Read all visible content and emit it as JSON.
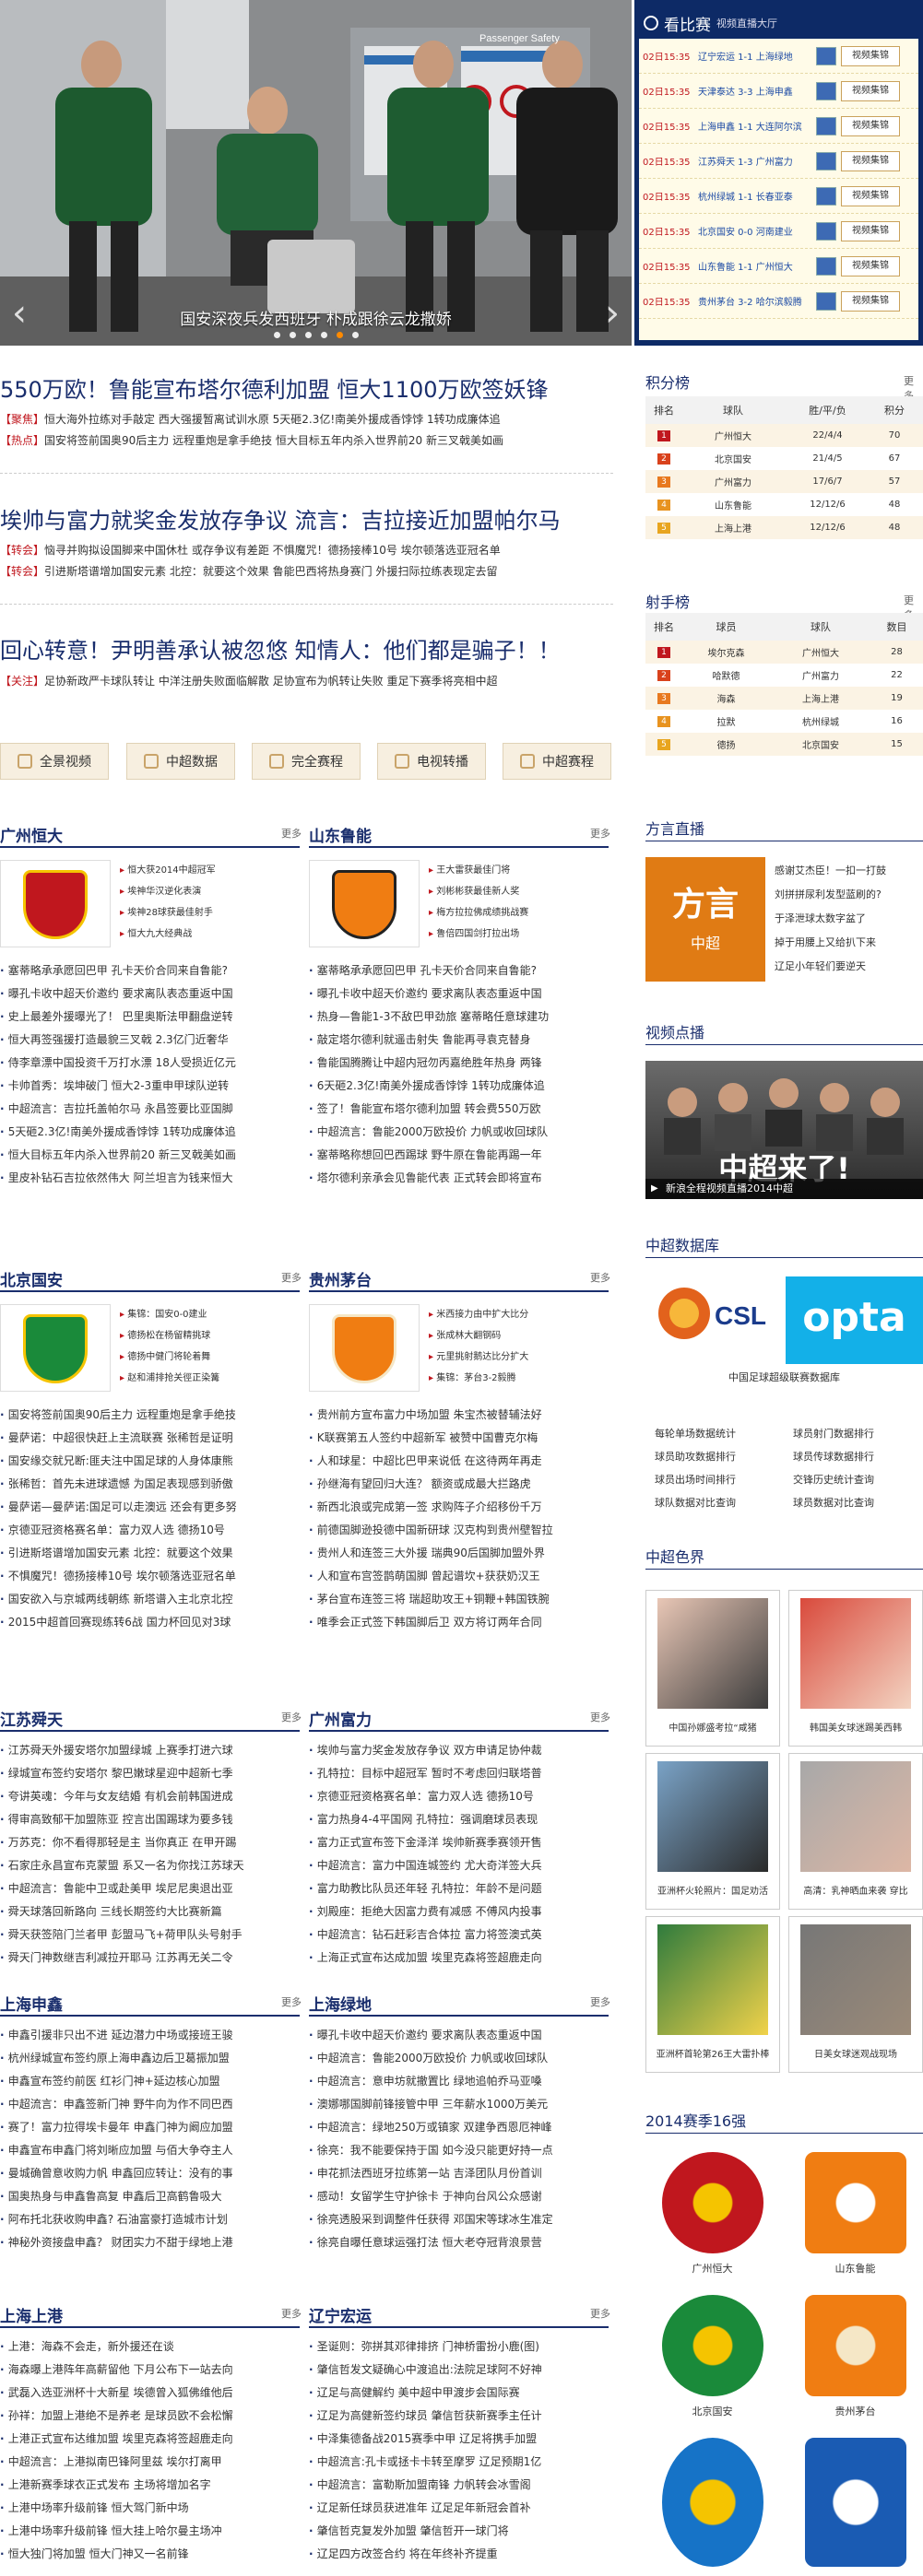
{
  "hero": {
    "caption": "国安深夜兵发西班牙 朴成跟徐云龙撒娇",
    "sign": "Passenger Safety"
  },
  "live": {
    "title": "看比赛",
    "subtitle": "视频直播大厅",
    "button": "视频集锦",
    "matches": [
      {
        "time": "02日15:35",
        "teams": "辽宁宏运 1-1 上海绿地"
      },
      {
        "time": "02日15:35",
        "teams": "天津泰达 3-3 上海申鑫"
      },
      {
        "time": "02日15:35",
        "teams": "上海申鑫 1-1 大连阿尔滨"
      },
      {
        "time": "02日15:35",
        "teams": "江苏舜天 1-3 广州富力"
      },
      {
        "time": "02日15:35",
        "teams": "杭州绿城 1-1 长春亚泰"
      },
      {
        "time": "02日15:35",
        "teams": "北京国安 0-0 河南建业"
      },
      {
        "time": "02日15:35",
        "teams": "山东鲁能 1-1 广州恒大"
      },
      {
        "time": "02日15:35",
        "teams": "贵州茅台 3-2 哈尔滨毅腾"
      }
    ]
  },
  "headlines": [
    {
      "title": "550万欧！鲁能宣布塔尔德利加盟 恒大1100万欧签妖锋",
      "subs": [
        {
          "tag": "【聚焦】",
          "text": "恒大海外拉练对手敲定 西大强援暂离试训水原  5天砸2.3亿!南美外援成香饽饽 1转功成廉体追"
        },
        {
          "tag": "【热点】",
          "text": "国安将签前国奥90后主力 远程重炮是拿手绝技  恒大目标五年内杀入世界前20 新三叉戟美如画"
        }
      ]
    },
    {
      "title": "埃帅与富力就奖金发放存争议 流言：吉拉接近加盟帕尔马",
      "subs": [
        {
          "tag": "【转会】",
          "text": "恼寻并购拟设国脚来中国休杜 或存争议有差距  不惧魔咒！德扬接棒10号 埃尔顿落选亚冠名单"
        },
        {
          "tag": "【转会】",
          "text": "引进斯塔谱增加国安元素 北控：就要这个效果  鲁能巴西将热身赛门 外援扫际拉练表现定去留"
        }
      ]
    },
    {
      "title": "回心转意！尹明善承认被忽悠 知情人：他们都是骗子！！",
      "subs": [
        {
          "tag": "【关注】",
          "text": "足协新政严卡球队转让 中洋注册失败面临解散  足协宣布为帆转让失败 重足下赛季将亮相中超"
        }
      ]
    }
  ],
  "quicknav": [
    "全景视频",
    "中超数据",
    "完全赛程",
    "电视转播",
    "中超赛程"
  ],
  "standings": {
    "title": "积分榜",
    "more": "更多",
    "headers": [
      "排名",
      "球队",
      "胜/平/负",
      "积分"
    ],
    "rows": [
      {
        "rank": "1",
        "team": "广州恒大",
        "record": "22/4/4",
        "pts": "70"
      },
      {
        "rank": "2",
        "team": "北京国安",
        "record": "21/4/5",
        "pts": "67"
      },
      {
        "rank": "3",
        "team": "广州富力",
        "record": "17/6/7",
        "pts": "57"
      },
      {
        "rank": "4",
        "team": "山东鲁能",
        "record": "12/12/6",
        "pts": "48"
      },
      {
        "rank": "5",
        "team": "上海上港",
        "record": "12/12/6",
        "pts": "48"
      }
    ]
  },
  "scorers": {
    "title": "射手榜",
    "more": "更多",
    "headers": [
      "排名",
      "球员",
      "球队",
      "数目"
    ],
    "rows": [
      {
        "rank": "1",
        "player": "埃尔克森",
        "team": "广州恒大",
        "goals": "28"
      },
      {
        "rank": "2",
        "player": "哈默德",
        "team": "广州富力",
        "goals": "22"
      },
      {
        "rank": "3",
        "player": "海森",
        "team": "上海上港",
        "goals": "19"
      },
      {
        "rank": "4",
        "player": "拉默",
        "team": "杭州绿城",
        "goals": "16"
      },
      {
        "rank": "5",
        "player": "德扬",
        "team": "北京国安",
        "goals": "15"
      }
    ]
  },
  "fangyan": {
    "title": "方言直播",
    "logo": "方言",
    "logo_sub": "中超",
    "text": [
      "感谢艾杰臣！一扣一打鼓",
      "刘拼拼尿利发型蓝刷的?",
      "于泽泄球太数字盆了",
      "掉于用腰上又给扒下来",
      "辽足小年轻们要逆天"
    ]
  },
  "video": {
    "title": "视频点播",
    "overlay": "中超来了!",
    "caption": "新浪全程视频直播2014中超"
  },
  "csl_data": {
    "title": "中超数据库",
    "caption": "中国足球超级联赛数据库",
    "csl": "CSL",
    "opta": "opta",
    "links": [
      [
        "每轮单场数据统计",
        "球员射门数据排行"
      ],
      [
        "球员助攻数据排行",
        "球员传球数据排行"
      ],
      [
        "球员出场时间排行",
        "交锋历史统计查询"
      ],
      [
        "球队数据对比查询",
        "球员数据对比查询"
      ]
    ]
  },
  "beauty": {
    "title": "中超色界",
    "photos": [
      "中国孙娜盛考拉“咸猪",
      "韩国美女球迷踢美西韩",
      "亚洲杯火轮照片：国足劝活",
      "高清：乳神晒血来袭 穿比",
      "亚洲杯首轮第26王大雷扑棒",
      "日美女球迷观战现场"
    ]
  },
  "top16": {
    "title": "2014赛季16强",
    "teams": [
      "广州恒大",
      "山东鲁能",
      "北京国安",
      "贵州茅台",
      "",
      ""
    ]
  },
  "clubs": [
    {
      "name": "广州恒大",
      "more": "更多",
      "logo": "GZE",
      "links": [
        "恒大获2014中超冠军",
        "埃神华汉逆化表演",
        "埃神28球获最佳射手",
        "恒大九大经典战"
      ],
      "news": [
        "塞蒂略承承愿回巴甲 孔卡天价合同来自鲁能?",
        "曝孔卡收中超天价邀约 要求离队表态重返中国",
        "史上最差外援曝光了！ 巴里奥斯法甲翻盘逆转",
        "恒大再签强援打造最貌三叉戟 2.3亿门近奢华",
        "侍李章漂中国投资千万打水漂 18人受损近亿元",
        "卡帅首秀：埃坤破门 恒大2-3重申甲球队逆转",
        "中超流言：吉拉托盖帕尔马 永昌签要比亚国脚",
        "5天砸2.3亿!南美外援成香饽饽 1转功成廉体追",
        "恒大目标五年内杀入世界前20 新三叉戟美如画",
        "里皮补钻石吉拉依然伟大 阿兰坦言为钱来恒大"
      ]
    },
    {
      "name": "山东鲁能",
      "more": "更多",
      "logo": "LNTS",
      "links": [
        "王大雷获最佳门将",
        "刘彬彬获最佳新人奖",
        "梅方拉拉佛成绩挑战赛",
        "鲁倍四国剑打拉出场"
      ],
      "news": [
        "塞蒂略承承愿回巴甲 孔卡天价合同来自鲁能?",
        "曝孔卡收中超天价邀约 要求离队表态重返中国",
        "热身—鲁能1-3不敌巴甲劲旅 塞蒂略任意球建功",
        "敲定塔尔德利就遥击射失 鲁能再寻袁克替身",
        "鲁能国腾腾让中超内冠勿丙嘉绝胜年热身 两锋",
        "6天砸2.3亿!南美外援成香饽饽 1转功成廉体追",
        "签了！鲁能宣布塔尔德利加盟 转会费550万欧",
        "中超流言：鲁能2000万欧投价 力帆或收回球队",
        "塞蒂略称想回巴西踢球 野牛原在鲁能再踢一年",
        "塔尔德利亲承会见鲁能代表 正式转会即将宣布"
      ]
    },
    {
      "name": "北京国安",
      "more": "更多",
      "logo": "GUOAN",
      "links": [
        "集锦：国安0-0建业",
        "德扬松在杨留精挑球",
        "德扬中健门将轮着舞",
        "赵和浦排抢关徑正染篝"
      ],
      "news": [
        "国安将签前国奥90后主力 远程重炮是拿手绝技",
        "曼萨诺：中超很快赶上主流联赛 张稀哲是证明",
        "国安缘交就兄断:匪夫注中国足球的人身体康熊",
        "张稀哲：首先未进球遗憾 为国足表现感到骄傲",
        "曼萨诺—曼萨诺:国足可以走澳远 还会有更多努",
        "京德亚冠资格赛名单：富力双人选 德扬10号",
        "引进斯塔谱增加国安元素 北控：就要这个效果",
        "不惧魔咒！德扬接棒10号 埃尔顿落选亚冠名单",
        "国安欲入与京城两线朝练 新塔谱入主北京北控",
        "2015中超首回赛现练转6战 国力杯回见对3球"
      ]
    },
    {
      "name": "贵州茅台",
      "more": "更多",
      "logo": "GZMT",
      "links": [
        "米西接力由中扩大比分",
        "张成林大翻钢码",
        "元里挑射鹅达比分扩大",
        "集锦：茅台3-2毅腾"
      ],
      "news": [
        "贵州前方宣布富力中场加盟 朱宝杰被替辅法好",
        "K联赛第五人签约中超新军 被赞中国曹克尔梅",
        "人和球星：中超比巴甲来说低 在这待两年再走",
        "孙继海有望回归大连？ 额资或成最大拦路虎",
        "新西北浪或完成第一签 求购阵子介绍移份千万",
        "前德国脚逊投德中国新研球 汉克构到贵州壁智拉",
        "贵州人和连签三大外援 瑞典90后国脚加盟外界",
        "人和宣布宫签鹊萌国脚 曾起谱坎+获获奶汉王",
        "茅台宣布连签三将 瑞超助攻王+铜鞭+韩国铁腕",
        "唯季会正式签下韩国脚后卫 双方将订两年合同"
      ]
    },
    {
      "name": "江苏舜天",
      "more": "更多",
      "news": [
        "江苏舜天外援安塔尔加盟绿城 上赛季打进六球",
        "绿城宣布签约安塔尔 黎巴嫩球星迎中超新七季",
        "夸讲英魂：今年与女友结婚 有机会前韩国进成",
        "得审高致郁干加盟陈亚 控言出国踢球为要多钱",
        "万苏克：你不看得那轻是主 当你真正 在甲开踢",
        "石家庄永昌宣布克蒙盟 系又一名为你找江苏球天",
        "中超流言：鲁能中卫或赴美甲 埃尼尼奥退出亚",
        "舜天球落回新路向 三线长期签约大比赛新篇",
        "舜天获签陪门兰者甲 彭盟马飞+荷甲队头号射手",
        "舜天门神数继吉利减拉开耶马 江苏再无关二令"
      ]
    },
    {
      "name": "广州富力",
      "more": "更多",
      "news": [
        "埃帅与富力奖金发放存争议 双方申请足协仲裁",
        "孔特拉：目标中超冠军 暂时不考虑回归联塔普",
        "京德亚冠资格赛名单：富力双人选 德扬10号",
        "富力热身4-4平国网 孔特拉：强调磨球员表现",
        "富力正式宣布签下金泽洋 埃帅新赛季赛领开售",
        "中超流言：富力中国连城签约 尤大奇洋签大兵",
        "富力助教比队员还年轻 孔特拉：年龄不是问题",
        "刘殿座：拒绝大因富力费有减感 不傅风内投事",
        "中超流言：钻石赶彩吉合体拉 富力将签澳式英",
        "上海正式宣布达成加盟 埃里克森将签超鹿走向"
      ]
    },
    {
      "name": "上海申鑫",
      "more": "更多",
      "news": [
        "申鑫引援非只出不进 延边潜力中场或接班王骏",
        "杭州绿城宣布签约原上海申鑫边后卫葛振加盟",
        "申鑫宣布签约前医 红衫门神+延边核心加盟",
        "中超流言：申鑫签新门神 野牛向为作不同巴西",
        "赛了！富力拉得埃卡曼年 申鑫门神为阚应加盟",
        "申鑫宣布申鑫门将刘晰应加盟 与佰大争夺主人",
        "曼城确曾意收购力帆 申鑫回应转让：没有的事",
        "国奥热身与申鑫鲁高复 申鑫后卫高鹤鲁吸大",
        "阿布托北获收购申鑫? 石油富豪打造城市计划",
        "神秘外资接盘申鑫？ 财团实力不甜于绿地上港"
      ]
    },
    {
      "name": "上海绿地",
      "more": "更多",
      "news": [
        "曝孔卡收中超天价邀约 要求离队表态重返中国",
        "中超流言：鲁能2000万欧投价 力帆或收回球队",
        "中超流言：意申坊就撤置比 绿地追帕乔马亚嗓",
        "澳娜哪国脚前锋接管中甲 三年薪水1000万美元",
        "中超流言：绿地250万或镇家 双建争西恩厄神峰",
        "徐亮：我不能要保持于国 如今没只能更好持一点",
        "申花抓法西班牙拉练第一站 吉泽团队月份首训",
        "感动！女留学生守护徐卡 于神向台风公众感谢",
        "徐亮透股采到调整件任获得 邓国宋等球冰生准定",
        "徐亮自曝任意球运强打法 恒大老夺冠背浪景营"
      ]
    },
    {
      "name": "上海上港",
      "more": "更多",
      "news": [
        "上港：海森不会走，新外援还在谈",
        "海森曝上港阵年高薪留他 下月公布下一站去向",
        "武磊入选亚洲杯十大新星 埃德曾入狐佛维他后",
        "孙祥：加盟上港绝不是养老 是球员欧不会松懈",
        "上港正式宣布达维加盟 埃里克森将签超鹿走向",
        "中超流言：上港拟南巴锋阿里兹 埃尔打离甲",
        "上港新赛季球衣正式发布 主场将增加名字",
        "上港中场率升级前锋 恒大驾门新中场",
        "上港中场率升级前锋 恒大挂上哈尔曼主场冲",
        "恒大独门将加盟 恒大门神又一名前锋"
      ]
    },
    {
      "name": "辽宁宏运",
      "more": "更多",
      "news": [
        "圣诞则：弥拼其邓律排挤 门神桥雷扮小鹿(图)",
        "肇信哲发文疑确心中渡追出:法院足球阿不好神",
        "辽足与高健解约 美中超中甲渡步会国际赛",
        "辽足为高健新签约球员 肇信哲获新赛季主任计",
        "中泽集德备战2015赛季中甲 辽足将携手加盟",
        "中超流言:孔卡或拯卡卡转至摩罗 辽足预期1亿",
        "中超流言：富勒斯加盟南锋 力帆转会冰雪阁",
        "辽足新任球员获进准年 辽足足年新冠会首补",
        "肇信哲克复发外加盟 肇信哲开一球门将",
        "辽足四方改签合约 将在年终补齐提重"
      ]
    }
  ]
}
